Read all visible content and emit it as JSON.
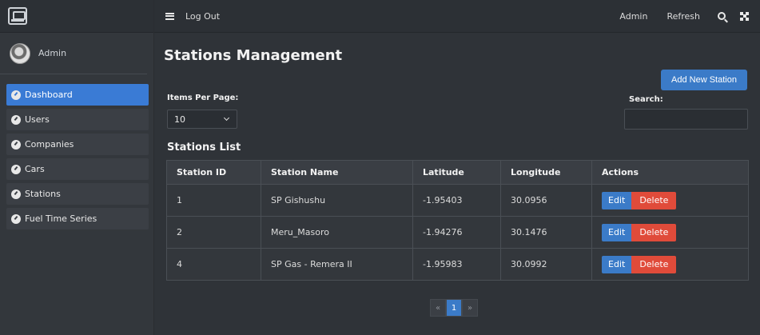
{
  "sidebar": {
    "user_name": "Admin",
    "items": [
      {
        "label": "Dashboard",
        "active": true
      },
      {
        "label": "Users"
      },
      {
        "label": "Companies"
      },
      {
        "label": "Cars"
      },
      {
        "label": "Stations"
      },
      {
        "label": "Fuel Time Series"
      }
    ]
  },
  "topbar": {
    "logout": "Log Out",
    "admin": "Admin",
    "refresh": "Refresh"
  },
  "main": {
    "title": "Stations Management",
    "add_button": "Add New Station",
    "items_per_page_label": "Items Per Page:",
    "items_per_page_value": "10",
    "search_label": "Search:",
    "search_value": "",
    "list_title": "Stations List",
    "columns": [
      "Station ID",
      "Station Name",
      "Latitude",
      "Longitude",
      "Actions"
    ],
    "rows": [
      {
        "id": "1",
        "name": "SP Gishushu",
        "lat": "-1.95403",
        "lon": "30.0956"
      },
      {
        "id": "2",
        "name": "Meru_Masoro",
        "lat": "-1.94276",
        "lon": "30.1476"
      },
      {
        "id": "4",
        "name": "SP Gas - Remera II",
        "lat": "-1.95983",
        "lon": "30.0992"
      }
    ],
    "edit_label": "Edit",
    "delete_label": "Delete",
    "pager": {
      "prev": "«",
      "current": "1",
      "next": "»"
    }
  }
}
